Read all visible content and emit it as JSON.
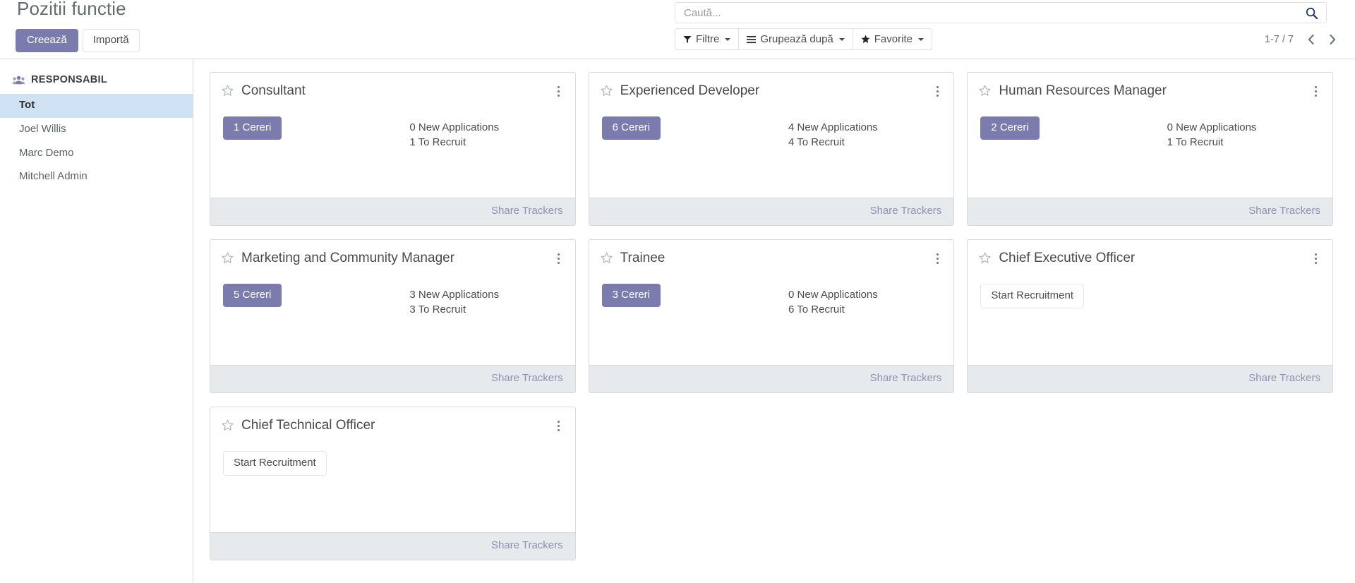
{
  "header": {
    "title": "Pozitii functie",
    "create_label": "Creează",
    "import_label": "Importă",
    "search_placeholder": "Caută...",
    "search_value": "",
    "filters_label": "Filtre",
    "groupby_label": "Grupează după",
    "favorites_label": "Favorite",
    "pager_value": "1-7 / 7"
  },
  "sidebar": {
    "section_title": "RESPONSABIL",
    "items": [
      {
        "label": "Tot",
        "active": true
      },
      {
        "label": "Joel Willis",
        "active": false
      },
      {
        "label": "Marc Demo",
        "active": false
      },
      {
        "label": "Mitchell Admin",
        "active": false
      }
    ]
  },
  "kanban": {
    "share_label": "Share Trackers",
    "start_recruitment_label": "Start Recruitment",
    "cards": [
      {
        "title": "Consultant",
        "badge": "1 Cereri",
        "new_applications": "0 New Applications",
        "to_recruit": "1 To Recruit",
        "has_badge": true
      },
      {
        "title": "Experienced Developer",
        "badge": "6 Cereri",
        "new_applications": "4 New Applications",
        "to_recruit": "4 To Recruit",
        "has_badge": true
      },
      {
        "title": "Human Resources Manager",
        "badge": "2 Cereri",
        "new_applications": "0 New Applications",
        "to_recruit": "1 To Recruit",
        "has_badge": true
      },
      {
        "title": "Marketing and Community Manager",
        "badge": "5 Cereri",
        "new_applications": "3 New Applications",
        "to_recruit": "3 To Recruit",
        "has_badge": true
      },
      {
        "title": "Trainee",
        "badge": "3 Cereri",
        "new_applications": "0 New Applications",
        "to_recruit": "6 To Recruit",
        "has_badge": true
      },
      {
        "title": "Chief Executive Officer",
        "badge": "Start Recruitment",
        "new_applications": "",
        "to_recruit": "",
        "has_badge": false
      },
      {
        "title": "Chief Technical Officer",
        "badge": "Start Recruitment",
        "new_applications": "",
        "to_recruit": "",
        "has_badge": false
      }
    ]
  },
  "colors": {
    "accent": "#7c7bad",
    "sidebar_active_bg": "#cfe2f3",
    "card_footer_bg": "#e7eaec",
    "share_link": "#8f90b4"
  }
}
